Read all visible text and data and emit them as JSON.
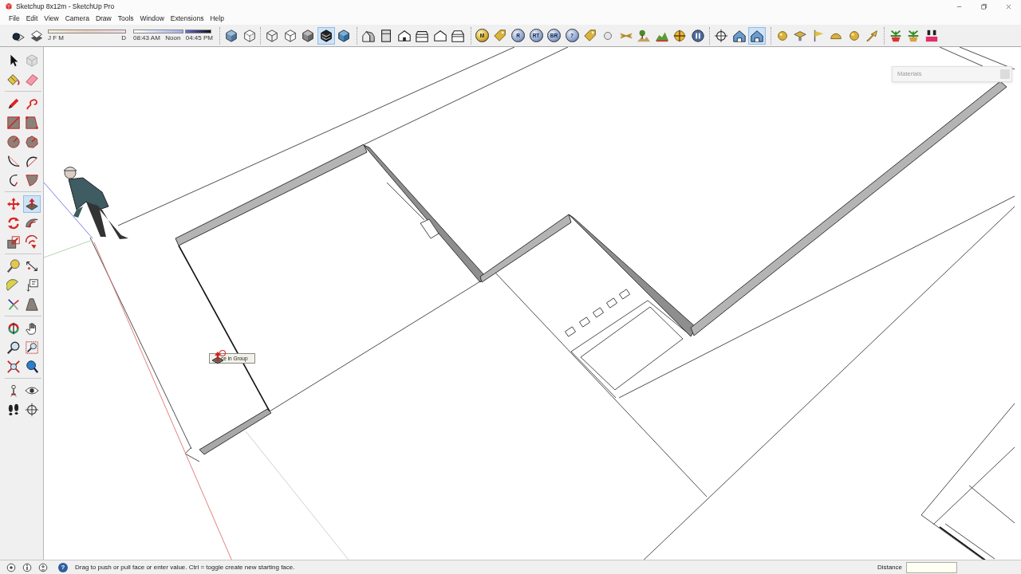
{
  "window": {
    "title": "Sketchup 8x12m - SketchUp Pro"
  },
  "menu": [
    "File",
    "Edit",
    "View",
    "Camera",
    "Draw",
    "Tools",
    "Window",
    "Extensions",
    "Help"
  ],
  "toolbar": {
    "shadow_buttons": [
      {
        "selected": false
      },
      {
        "selected": false
      }
    ],
    "month_slider": {
      "labels": [
        "J F M",
        "D"
      ]
    },
    "time_slider": {
      "labels": [
        "08:43 AM",
        "Noon",
        "04:45 PM"
      ]
    },
    "button_groups": [
      [
        {
          "selected": false
        },
        {
          "selected": false
        }
      ],
      [
        {
          "selected": false
        },
        {
          "selected": false
        },
        {
          "selected": false
        },
        {
          "selected": true
        },
        {
          "selected": false
        }
      ],
      [
        {
          "selected": false
        },
        {
          "selected": false
        },
        {
          "selected": false
        },
        {
          "selected": false
        },
        {
          "selected": false
        },
        {
          "selected": false
        }
      ],
      [
        {
          "selected": false,
          "label": "M"
        },
        {
          "selected": false
        },
        {
          "selected": false,
          "label": "R"
        },
        {
          "selected": false,
          "label": "RT"
        },
        {
          "selected": false,
          "label": "BR"
        },
        {
          "selected": false,
          "label": "?"
        },
        {
          "selected": false
        },
        {
          "selected": false
        },
        {
          "selected": false
        },
        {
          "selected": false
        },
        {
          "selected": false
        },
        {
          "selected": false
        },
        {
          "selected": false
        }
      ],
      [
        {
          "selected": false
        },
        {
          "selected": false
        },
        {
          "selected": true
        }
      ],
      [
        {
          "selected": false
        },
        {
          "selected": false
        },
        {
          "selected": false
        },
        {
          "selected": false
        },
        {
          "selected": false
        },
        {
          "selected": false
        }
      ],
      [
        {
          "selected": false
        },
        {
          "selected": false
        },
        {
          "selected": false
        }
      ]
    ]
  },
  "tool_palette": [
    [
      {
        "selected": false
      },
      {
        "selected": false
      },
      {
        "selected": false
      },
      {
        "selected": false
      }
    ],
    [
      {
        "selected": false
      },
      {
        "selected": false
      },
      {
        "selected": false
      },
      {
        "selected": false
      },
      {
        "selected": false
      },
      {
        "selected": false
      },
      {
        "selected": false
      },
      {
        "selected": false
      },
      {
        "selected": false
      },
      {
        "selected": false
      }
    ],
    [
      {
        "selected": false
      },
      {
        "selected": true
      },
      {
        "selected": false
      },
      {
        "selected": false
      },
      {
        "selected": false
      },
      {
        "selected": false
      }
    ],
    [
      {
        "selected": false
      },
      {
        "selected": false
      },
      {
        "selected": false
      },
      {
        "selected": false
      },
      {
        "selected": false
      },
      {
        "selected": false
      }
    ],
    [
      {
        "selected": false
      },
      {
        "selected": false
      },
      {
        "selected": false
      },
      {
        "selected": false
      },
      {
        "selected": false
      },
      {
        "selected": false
      }
    ],
    [
      {
        "selected": false
      },
      {
        "selected": false
      },
      {
        "selected": false
      },
      {
        "selected": false
      }
    ]
  ],
  "viewport": {
    "tooltip": "ce in Group",
    "tray": {
      "title": "Materials"
    }
  },
  "status_bar": {
    "help": "?",
    "hint": "Drag to push or pull face or enter value. Ctrl = toggle create new starting face.",
    "measurement_label": "Distance"
  }
}
